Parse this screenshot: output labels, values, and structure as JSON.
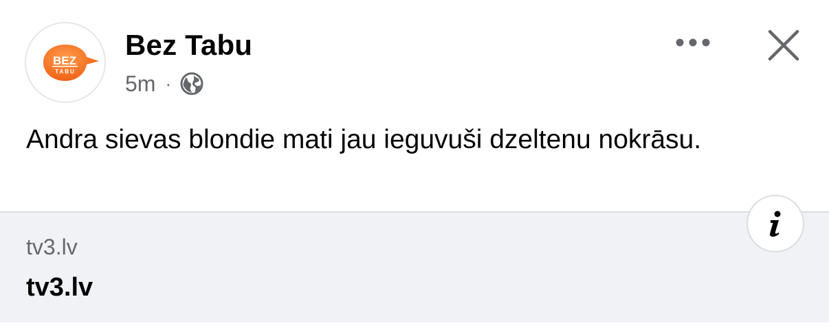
{
  "post": {
    "page_name": "Bez Tabu",
    "avatar": {
      "logo_word": "BEZ",
      "logo_subword": "TABU",
      "accent_color": "#f26b22"
    },
    "timestamp": "5m",
    "separator": "·",
    "audience_icon": "globe-icon",
    "more_icon": "more-options-icon",
    "close_icon": "close-icon",
    "text": "Andra sievas blondie mati jau ieguvuši dzeltenu nokrāsu."
  },
  "link_preview": {
    "domain": "tv3.lv",
    "title": "tv3.lv",
    "info_icon": "info-icon"
  },
  "colors": {
    "text_primary": "#050505",
    "text_secondary": "#65676b",
    "card_background": "#f0f2f5",
    "divider": "#dadde1"
  }
}
